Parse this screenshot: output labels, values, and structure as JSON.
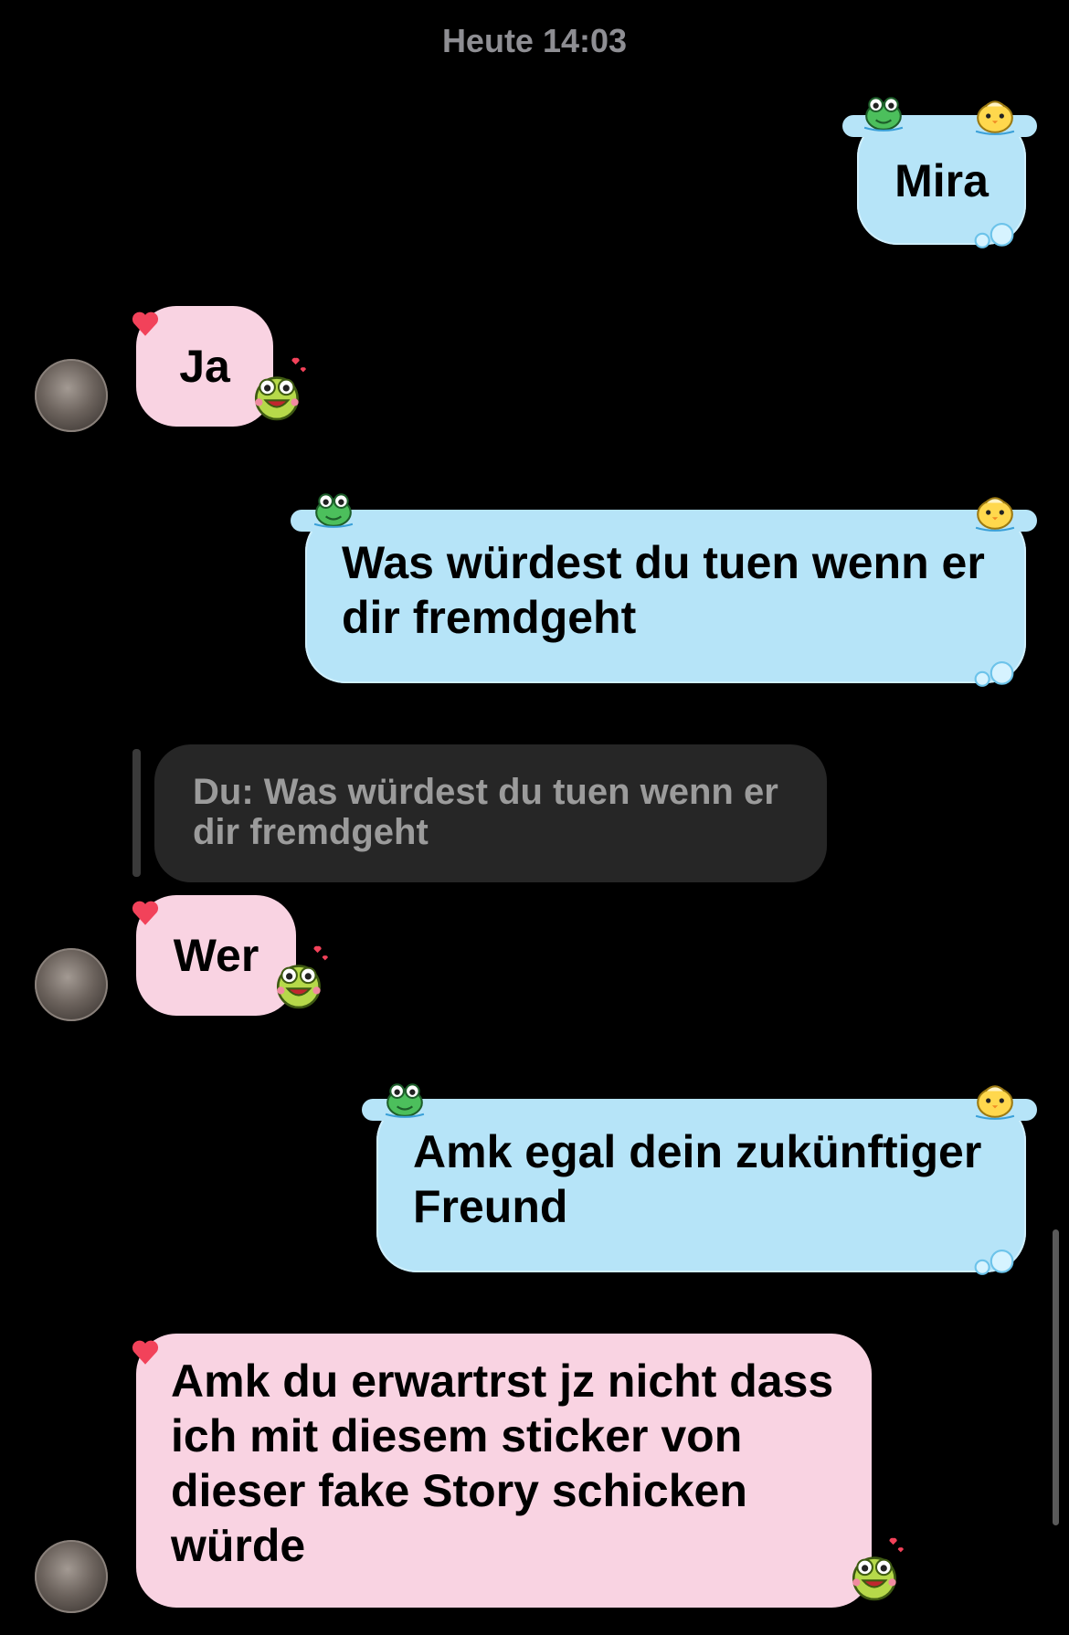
{
  "chat": {
    "timestamp": "Heute 14:03",
    "messages": [
      {
        "from": "me",
        "text": "Mira"
      },
      {
        "from": "them",
        "text": "Ja"
      },
      {
        "from": "me",
        "text": "Was würdest du tuen wenn er dir fremdgeht"
      },
      {
        "from": "them",
        "reply_to": "Du: Was würdest du tuen wenn er dir fremdgeht",
        "text": "Wer"
      },
      {
        "from": "me",
        "text": "Amk egal dein zukünftiger Freund"
      },
      {
        "from": "them",
        "text": "Amk du erwartrst jz nicht dass ich mit diesem sticker von dieser fake Story schicken würde"
      }
    ]
  },
  "colors": {
    "background": "#000000",
    "outgoing_bubble": "#b6e4f8",
    "incoming_bubble": "#f9d3e2",
    "reply_quote": "#262626",
    "timestamp": "#8e8e93",
    "heart": "#f2425a"
  },
  "icons": {
    "bubble_decor": [
      "frog-sticker-icon",
      "chick-sticker-icon",
      "bubbles-icon",
      "heart-icon"
    ],
    "avatar": "avatar"
  }
}
